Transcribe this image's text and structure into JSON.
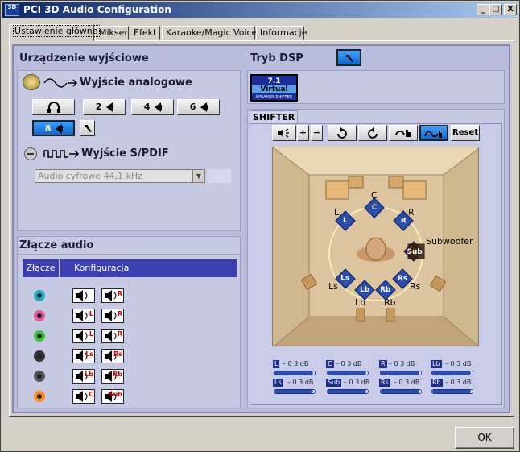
{
  "window": {
    "title": "PCI 3D Audio Configuration",
    "icon_label": "3D",
    "buttons": [
      "_",
      "□",
      "X"
    ]
  },
  "tabs": [
    {
      "label": "Ustawienie główne",
      "active": true
    },
    {
      "label": "Mikser"
    },
    {
      "label": "Efekt"
    },
    {
      "label": "Karaoke/Magic Voice"
    },
    {
      "label": "Informacje"
    }
  ],
  "output": {
    "title": "Urządzenie wyjściowe",
    "analog_label": "Wyjście analogowe",
    "speaker_buttons": [
      "2",
      "4",
      "6",
      "8"
    ],
    "selected_speakers": "8",
    "spdif_label": "Wyjście S/PDIF",
    "spdif_select": "Audio cyfrowe 44,1 kHz"
  },
  "dsp": {
    "title": "Tryb DSP",
    "virtual": {
      "line1": "7.1",
      "line2": "Virtual",
      "line3": "SPEAKER SHIFTER"
    },
    "shifter_tab": "SHIFTER",
    "reset_label": "Reset",
    "positions": {
      "C": "C",
      "L": "L",
      "R": "R",
      "Ls": "Ls",
      "Rs": "Rs",
      "Lb": "Lb",
      "Rb": "Rb",
      "Sub": "Sub",
      "Subwoofer": "Subwoofer"
    },
    "meters": [
      {
        "tag": "L",
        "db": "– 0 3 dB",
        "level": 0.95
      },
      {
        "tag": "C",
        "db": "– 0 3 dB",
        "level": 0.95
      },
      {
        "tag": "R",
        "db": "– 0 3 dB",
        "level": 0.95
      },
      {
        "tag": "Lb",
        "db": "– 0 3 dB",
        "level": 0.95
      },
      {
        "tag": "Ls",
        "db": "– 0 3 dB",
        "level": 0.95
      },
      {
        "tag": "Sub",
        "db": "– 0 3 dB",
        "level": 0.95
      },
      {
        "tag": "Rs",
        "db": "– 0 3 dB",
        "level": 0.95
      },
      {
        "tag": "Rb",
        "db": "– 0 3 dB",
        "level": 0.95
      }
    ]
  },
  "connector": {
    "title": "Złącze audio",
    "col1": "Złącze",
    "col2": "Konfiguracja",
    "jack_colors": [
      "#1ab0c8",
      "#e05a9a",
      "#3cc43c",
      "#333333",
      "#555555",
      "#ff8a20"
    ],
    "icon_tags": [
      [
        "",
        "R"
      ],
      [
        "L",
        "R"
      ],
      [
        "L",
        "R"
      ],
      [
        "Ls",
        "Rs"
      ],
      [
        "Lb",
        "Rb"
      ],
      [
        "C",
        "Sub"
      ]
    ]
  },
  "footer": {
    "ok_label": "OK"
  }
}
